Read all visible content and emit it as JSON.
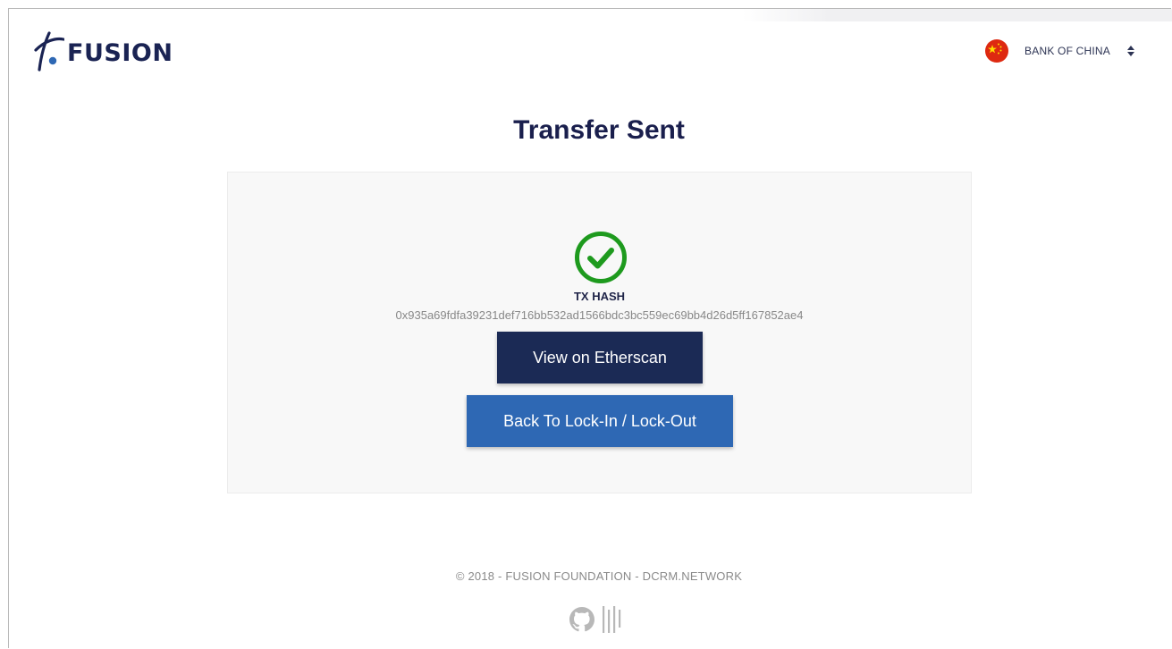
{
  "header": {
    "logo_text": "FUSION",
    "bank_selector": {
      "selected": "BANK OF CHINA",
      "flag_icon": "china-flag-icon"
    }
  },
  "main": {
    "title": "Transfer Sent",
    "status_icon": "check-circle-icon",
    "tx_label": "TX HASH",
    "tx_hash": "0x935a69fdfa39231def716bb532ad1566bdc3bc559ec69bb4d26d5ff167852ae4",
    "etherscan_button": "View on Etherscan",
    "back_button": "Back To Lock-In / Lock-Out"
  },
  "footer": {
    "copyright": "© 2018 - FUSION FOUNDATION - DCRM.NETWORK",
    "icons": [
      "github-icon",
      "barcode-icon"
    ]
  },
  "colors": {
    "brand_navy": "#1b2a55",
    "primary_blue": "#2e68b4",
    "success_green": "#1e9a1e",
    "flag_red": "#de2910"
  }
}
